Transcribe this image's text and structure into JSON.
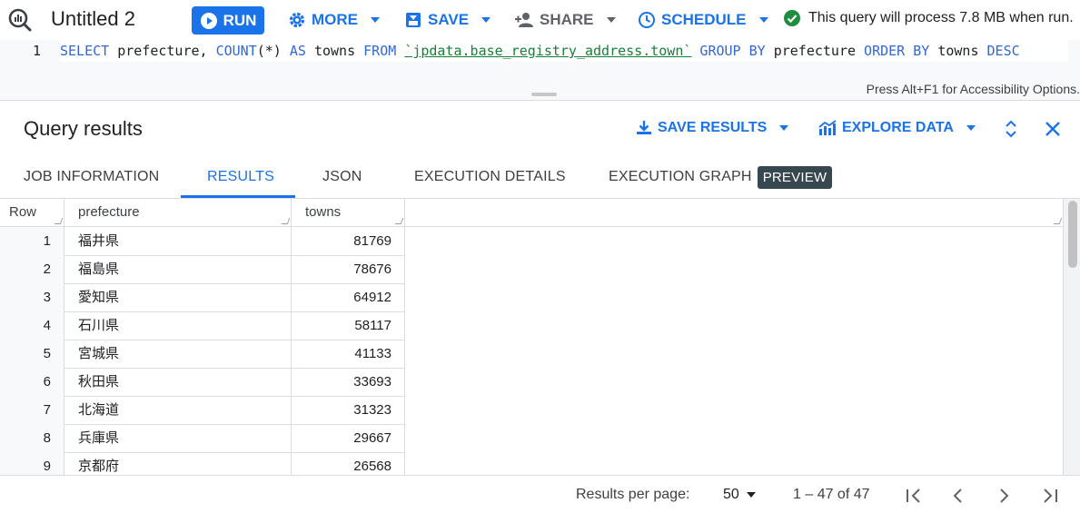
{
  "toolbar": {
    "tab_title": "Untitled 2",
    "run_label": "RUN",
    "more_label": "MORE",
    "save_label": "SAVE",
    "share_label": "SHARE",
    "schedule_label": "SCHEDULE",
    "status_text": "This query will process 7.8 MB when run."
  },
  "editor": {
    "line_number": "1",
    "tokens": {
      "select": "SELECT",
      "t1": " prefecture, ",
      "count": "COUNT",
      "t2": "(*) ",
      "as": "AS",
      "t3": " towns ",
      "from": "FROM",
      "t4": " ",
      "table": "`jpdata.base_registry_address.town`",
      "t5": " ",
      "group": "GROUP BY",
      "t6": " prefecture ",
      "order": "ORDER BY",
      "t7": " towns ",
      "desc": "DESC"
    },
    "a11y_hint": "Press Alt+F1 for Accessibility Options."
  },
  "results": {
    "title": "Query results",
    "save_results_label": "SAVE RESULTS",
    "explore_data_label": "EXPLORE DATA"
  },
  "tabs": [
    {
      "label": "JOB INFORMATION"
    },
    {
      "label": "RESULTS"
    },
    {
      "label": "JSON"
    },
    {
      "label": "EXECUTION DETAILS"
    },
    {
      "label": "EXECUTION GRAPH"
    }
  ],
  "preview_badge": "PREVIEW",
  "grid": {
    "columns": [
      "Row",
      "prefecture",
      "towns"
    ],
    "rows": [
      {
        "row": "1",
        "prefecture": "福井県",
        "towns": "81769"
      },
      {
        "row": "2",
        "prefecture": "福島県",
        "towns": "78676"
      },
      {
        "row": "3",
        "prefecture": "愛知県",
        "towns": "64912"
      },
      {
        "row": "4",
        "prefecture": "石川県",
        "towns": "58117"
      },
      {
        "row": "5",
        "prefecture": "宮城県",
        "towns": "41133"
      },
      {
        "row": "6",
        "prefecture": "秋田県",
        "towns": "33693"
      },
      {
        "row": "7",
        "prefecture": "北海道",
        "towns": "31323"
      },
      {
        "row": "8",
        "prefecture": "兵庫県",
        "towns": "29667"
      },
      {
        "row": "9",
        "prefecture": "京都府",
        "towns": "26568"
      }
    ]
  },
  "footer": {
    "per_page_label": "Results per page:",
    "per_page_value": "50",
    "range_text": "1 – 47 of 47"
  },
  "icons": {
    "app": "bigquery-magnifier-icon",
    "run": "play-circle-icon",
    "more": "gear-icon",
    "save": "save-icon",
    "share": "person-add-icon",
    "schedule": "clock-icon",
    "status": "check-circle-icon",
    "save_results": "download-icon",
    "explore_data": "chart-icon",
    "expand": "unfold-icon",
    "close": "close-icon",
    "first_page": "first-page-icon",
    "prev_page": "chevron-left-icon",
    "next_page": "chevron-right-icon",
    "last_page": "last-page-icon"
  },
  "colors": {
    "accent": "#1a73e8",
    "success": "#1e8e3e",
    "keyword": "#3367d6",
    "table_ref": "#188038",
    "badge_bg": "#37474f"
  }
}
